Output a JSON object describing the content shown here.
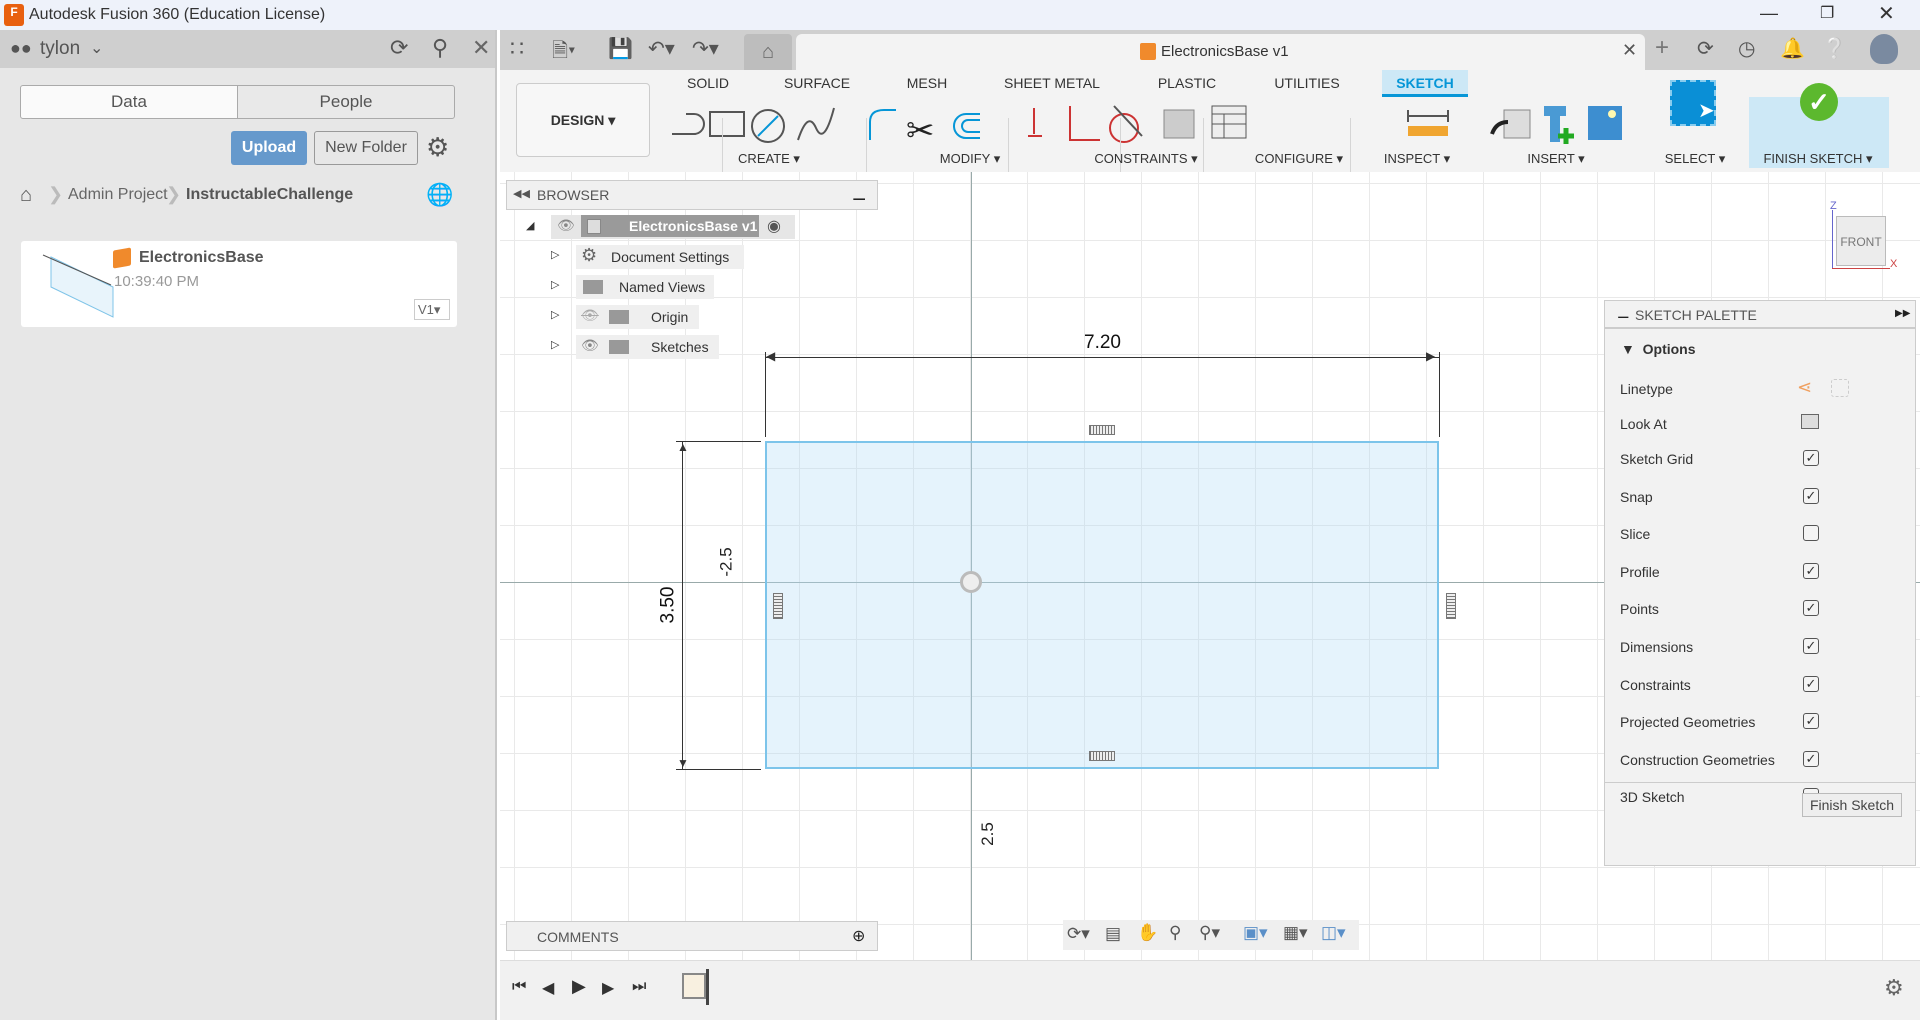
{
  "window": {
    "title": "Autodesk Fusion 360 (Education License)",
    "app_icon": "F"
  },
  "left_panel": {
    "user": "tylon",
    "tabs": [
      "Data",
      "People"
    ],
    "upload": "Upload",
    "new_folder": "New Folder",
    "breadcrumb": [
      "Admin Project",
      "InstructableChallenge"
    ],
    "file": {
      "name": "ElectronicsBase",
      "time": "10:39:40 PM",
      "version": "V1"
    }
  },
  "document_tab": {
    "title": "ElectronicsBase v1"
  },
  "toolbar": {
    "workspace": "DESIGN",
    "tabs": [
      "SOLID",
      "SURFACE",
      "MESH",
      "SHEET METAL",
      "PLASTIC",
      "UTILITIES",
      "SKETCH"
    ],
    "active_tab": "SKETCH",
    "groups": [
      "CREATE",
      "MODIFY",
      "CONSTRAINTS",
      "CONFIGURE",
      "INSPECT",
      "INSERT",
      "SELECT",
      "FINISH SKETCH"
    ],
    "accent": "#0696d7"
  },
  "browser": {
    "title": "BROWSER",
    "root": "ElectronicsBase v1",
    "items": [
      "Document Settings",
      "Named Views",
      "Origin",
      "Sketches"
    ]
  },
  "comments": {
    "title": "COMMENTS"
  },
  "sketch": {
    "width_dim": "7.20",
    "height_dim": "3.50",
    "axis_label_neg": "-2.5",
    "axis_label_pos": "2.5"
  },
  "viewcube": {
    "face": "FRONT",
    "z": "Z",
    "x": "X"
  },
  "palette": {
    "title": "SKETCH PALETTE",
    "section": "Options",
    "linetype": "Linetype",
    "look_at": "Look At",
    "options": [
      {
        "label": "Sketch Grid",
        "checked": true
      },
      {
        "label": "Snap",
        "checked": true
      },
      {
        "label": "Slice",
        "checked": false
      },
      {
        "label": "Profile",
        "checked": true
      },
      {
        "label": "Points",
        "checked": true
      },
      {
        "label": "Dimensions",
        "checked": true
      },
      {
        "label": "Constraints",
        "checked": true
      },
      {
        "label": "Projected Geometries",
        "checked": true
      },
      {
        "label": "Construction Geometries",
        "checked": true
      },
      {
        "label": "3D Sketch",
        "checked": false
      }
    ],
    "finish": "Finish Sketch"
  }
}
